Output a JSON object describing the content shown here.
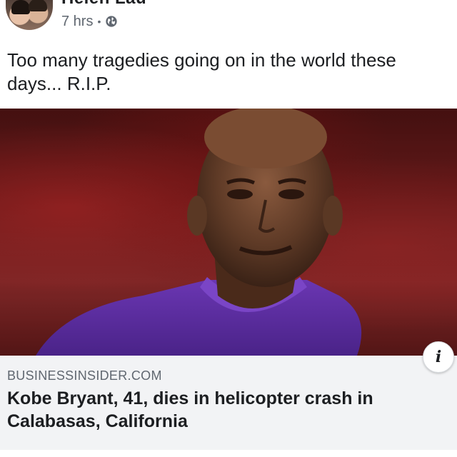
{
  "post": {
    "author_name": "Helen Lau",
    "timestamp": "7 hrs",
    "separator": "•",
    "privacy_icon": "globe-icon",
    "text": "Too many tragedies going on in the world these days... R.I.P."
  },
  "link_preview": {
    "domain": "BUSINESSINSIDER.COM",
    "title": "Kobe Bryant, 41, dies in helicopter crash in Calabasas, California",
    "info_icon": "info-icon",
    "info_glyph": "i"
  },
  "colors": {
    "text_primary": "#1c1e21",
    "text_secondary": "#606770",
    "link_box_bg": "#f2f3f5",
    "jersey_purple": "#5b2d9c"
  }
}
